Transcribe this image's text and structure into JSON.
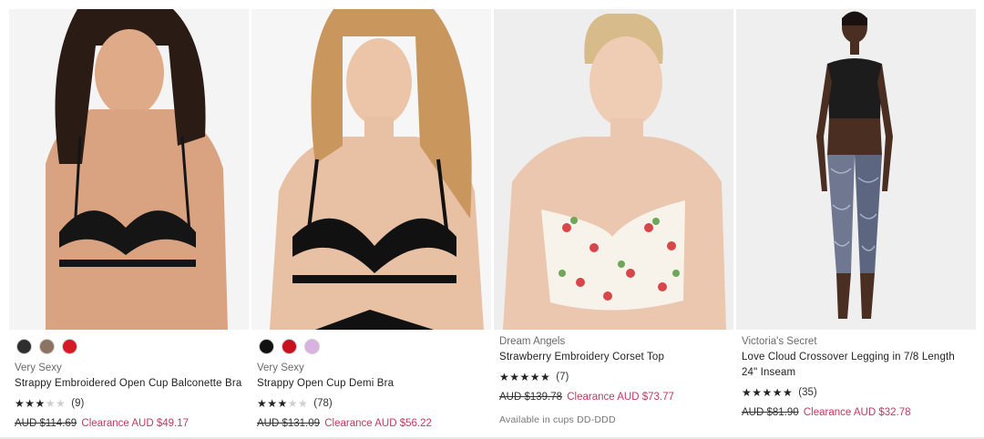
{
  "products": [
    {
      "swatches": [
        "#2e2e2e",
        "#8a7360",
        "#d41a24"
      ],
      "brand": "Very Sexy",
      "name": "Strappy Embroidered Open Cup Balconette Bra",
      "rating_value": 2.5,
      "stars": "★★★",
      "stars_off": "★★",
      "reviews": "(9)",
      "original_price": "AUD $114.69",
      "sale_price": "Clearance AUD $49.17",
      "note": ""
    },
    {
      "swatches": [
        "#111111",
        "#c8111f",
        "#d9b3e0"
      ],
      "brand": "Very Sexy",
      "name": "Strappy Open Cup Demi Bra",
      "rating_value": 3,
      "stars": "★★★",
      "stars_off": "★★",
      "reviews": "(78)",
      "original_price": "AUD $131.09",
      "sale_price": "Clearance AUD $56.22",
      "note": ""
    },
    {
      "swatches": [],
      "brand": "Dream Angels",
      "name": "Strawberry Embroidery Corset Top",
      "rating_value": 4.5,
      "stars": "★★★★★",
      "stars_off": "",
      "reviews": "(7)",
      "original_price": "AUD $139.78",
      "sale_price": "Clearance AUD $73.77",
      "note": "Available in cups DD-DDD"
    },
    {
      "swatches": [],
      "brand": "Victoria's Secret",
      "name": "Love Cloud Crossover Legging in 7/8 Length 24\" Inseam",
      "rating_value": 4.5,
      "stars": "★★★★★",
      "stars_off": "",
      "reviews": "(35)",
      "original_price": "AUD $81.90",
      "sale_price": "Clearance AUD $32.78",
      "note": ""
    }
  ],
  "colors": {
    "sale": "#c3395e",
    "brand_text": "#6a6a6a"
  }
}
